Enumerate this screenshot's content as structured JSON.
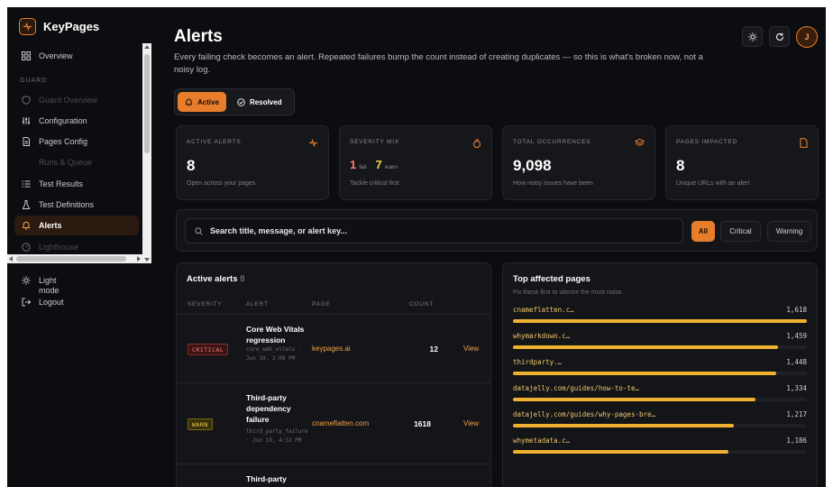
{
  "brand": {
    "name": "KeyPages"
  },
  "sidebar": {
    "overview": "Overview",
    "section": "GUARD",
    "guard_overview": "Guard Overview",
    "configuration": "Configuration",
    "pages_config": "Pages Config",
    "runs_queue": "Runs & Queue",
    "test_results": "Test Results",
    "test_definitions": "Test Definitions",
    "alerts": "Alerts",
    "lighthouse": "Lighthouse",
    "light_mode": "Light",
    "light_mode2": "mode",
    "logout": "Logout"
  },
  "header": {
    "title": "Alerts",
    "subtitle": "Every failing check becomes an alert. Repeated failures bump the count instead of creating duplicates — so this is what's broken now, not a noisy log.",
    "avatar_initial": "J"
  },
  "toggle": {
    "active": "Active",
    "resolved": "Resolved"
  },
  "stats": {
    "active_label": "ACTIVE ALERTS",
    "active_value": "8",
    "active_desc": "Open across your pages",
    "severity_label": "SEVERITY MIX",
    "sev_fail_num": "1",
    "sev_fail_lbl": "fail",
    "sev_warn_num": "7",
    "sev_warn_lbl": "warn",
    "severity_desc": "Tackle critical first",
    "total_label": "TOTAL OCCURRENCES",
    "total_value": "9,098",
    "total_desc": "How noisy issues have been",
    "pages_label": "PAGES IMPACTED",
    "pages_value": "8",
    "pages_desc": "Unique URLs with an alert"
  },
  "filters": {
    "search_placeholder": "Search title, message, or alert key...",
    "all": "All",
    "critical": "Critical",
    "warning": "Warning"
  },
  "active_alerts": {
    "title": "Active alerts",
    "count": "8",
    "headers": {
      "severity": "SEVERITY",
      "alert": "ALERT",
      "page": "PAGE",
      "count": "COUNT"
    },
    "rows": [
      {
        "severity": "CRITICAL",
        "title": "Core Web Vitals regression",
        "meta": "core_web_vitals · Jun 19, 3:08 PM",
        "page": "keypages.ai",
        "count": "12",
        "action": "View"
      },
      {
        "severity": "WARN",
        "title": "Third-party dependency failure",
        "meta": "third_party_failure · Jun 19, 4:32 PM",
        "page": "cnameflatten.com",
        "count": "1618",
        "action": "View"
      },
      {
        "severity": "",
        "title": "Third-party",
        "meta": "",
        "page": "",
        "count": "",
        "action": ""
      }
    ]
  },
  "top_pages": {
    "title": "Top affected pages",
    "subtitle": "Fix these first to silence the most noise.",
    "items": [
      {
        "label": "cnameflatten.c…",
        "value": "1,618",
        "fraction": 1.0
      },
      {
        "label": "whymarkdown.c…",
        "value": "1,459",
        "fraction": 0.902
      },
      {
        "label": "thirdparty.…",
        "value": "1,448",
        "fraction": 0.895
      },
      {
        "label": "datajelly.com/guides/how-to-te…",
        "value": "1,334",
        "fraction": 0.825
      },
      {
        "label": "datajelly.com/guides/why-pages-bre…",
        "value": "1,217",
        "fraction": 0.752
      },
      {
        "label": "whymetadata.c…",
        "value": "1,186",
        "fraction": 0.733
      }
    ]
  },
  "colors": {
    "accent": "#e87d2c",
    "critical": "#ff7a6e",
    "warning": "#f3cf52",
    "bar": "#f0b030"
  }
}
